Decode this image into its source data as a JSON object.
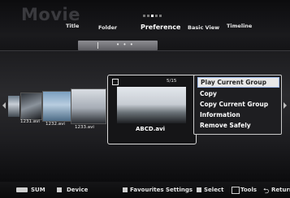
{
  "app": {
    "title": "Movie"
  },
  "tabs": [
    {
      "label": "Title"
    },
    {
      "label": "Folder"
    },
    {
      "label": "Preference"
    },
    {
      "label": "Basic View"
    },
    {
      "label": "Timeline"
    }
  ],
  "tab_bar": {
    "indicator": "• • •"
  },
  "page_dots": {
    "total": 5,
    "active": 3
  },
  "files": [
    {
      "name": "1231.avi",
      "icon": "video-thumbnail"
    },
    {
      "name": "1232.avi",
      "icon": "video-thumbnail"
    },
    {
      "name": "1233.avi",
      "icon": "video-thumbnail"
    }
  ],
  "selected": {
    "name": "ABCD.avi",
    "counter": "5/15",
    "checked": false
  },
  "context_menu": {
    "items": [
      "Play Current Group",
      "Copy",
      "Copy Current Group",
      "Information",
      "Remove Safely"
    ],
    "highlighted": 0
  },
  "bottom_bar": {
    "sum": "SUM",
    "device": "Device",
    "favourites": "Favourites Settings",
    "select": "Select",
    "tools": "Tools",
    "return": "Return"
  }
}
